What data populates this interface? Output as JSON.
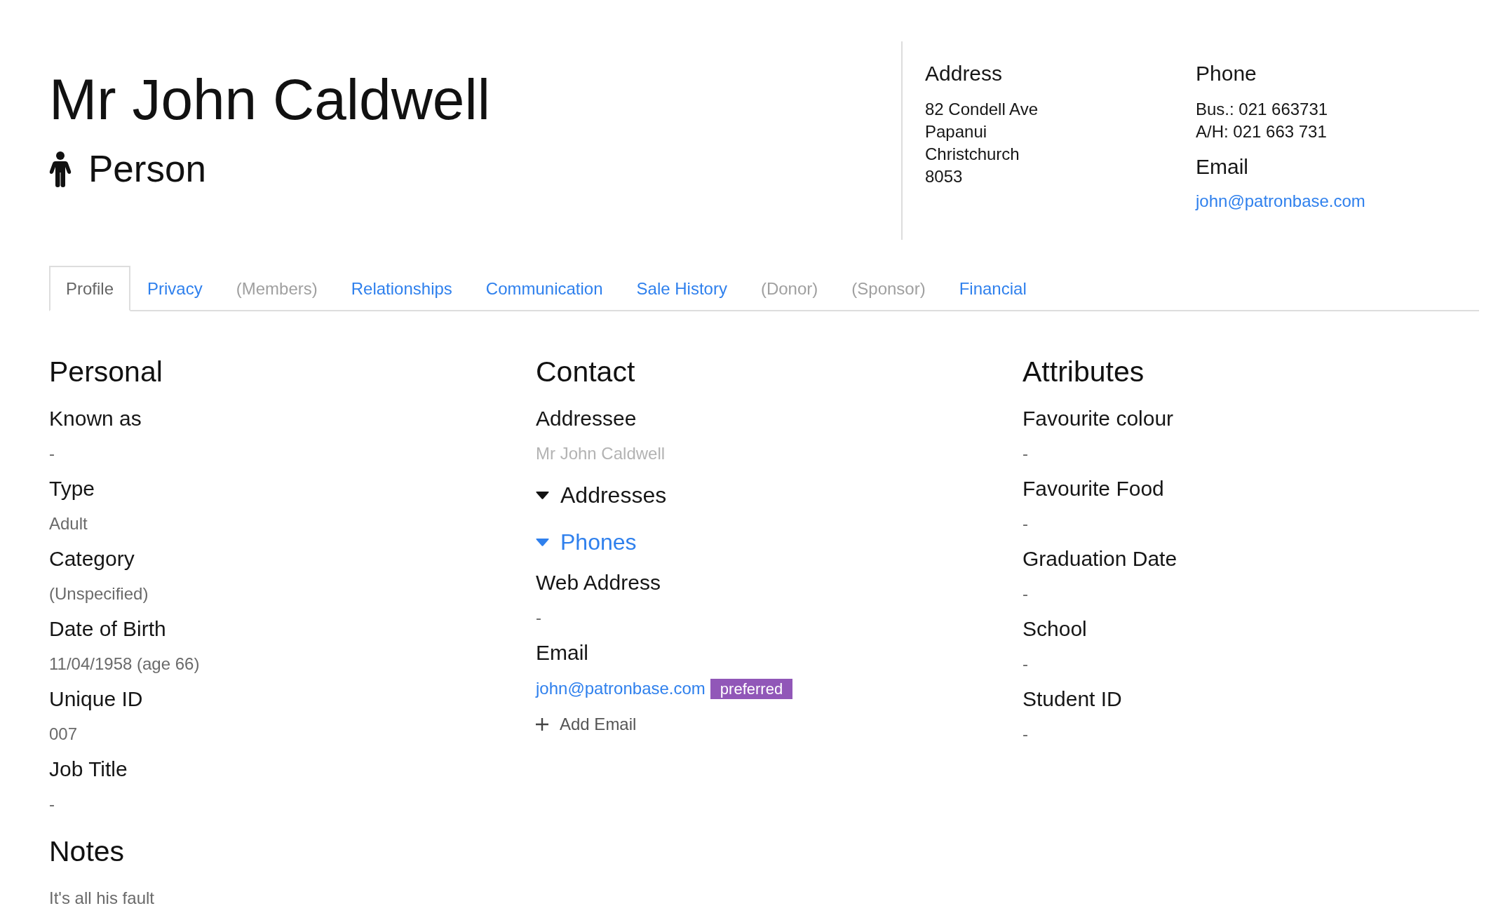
{
  "header": {
    "name": "Mr John Caldwell",
    "entity_type": "Person",
    "address": {
      "heading": "Address",
      "lines": [
        "82 Condell Ave",
        "Papanui",
        "Christchurch",
        "8053"
      ]
    },
    "phone": {
      "heading": "Phone",
      "lines": [
        "Bus.: 021 663731",
        "A/H: 021 663 731"
      ]
    },
    "email": {
      "heading": "Email",
      "address": "john@patronbase.com"
    }
  },
  "tabs": [
    {
      "label": "Profile",
      "selected": true,
      "disabled": false
    },
    {
      "label": "Privacy",
      "selected": false,
      "disabled": false
    },
    {
      "label": "(Members)",
      "selected": false,
      "disabled": true
    },
    {
      "label": "Relationships",
      "selected": false,
      "disabled": false
    },
    {
      "label": "Communication",
      "selected": false,
      "disabled": false
    },
    {
      "label": "Sale History",
      "selected": false,
      "disabled": false
    },
    {
      "label": "(Donor)",
      "selected": false,
      "disabled": true
    },
    {
      "label": "(Sponsor)",
      "selected": false,
      "disabled": true
    },
    {
      "label": "Financial",
      "selected": false,
      "disabled": false
    }
  ],
  "personal": {
    "heading": "Personal",
    "fields": [
      {
        "label": "Known as",
        "value": "-"
      },
      {
        "label": "Type",
        "value": "Adult"
      },
      {
        "label": "Category",
        "value": "(Unspecified)"
      },
      {
        "label": "Date of Birth",
        "value": "11/04/1958 (age 66)"
      },
      {
        "label": "Unique ID",
        "value": "007"
      },
      {
        "label": "Job Title",
        "value": "-"
      }
    ]
  },
  "notes": {
    "heading": "Notes",
    "text": "It's all his fault"
  },
  "contact": {
    "heading": "Contact",
    "items": [
      {
        "kind": "field",
        "label": "Addressee",
        "value": "Mr John Caldwell",
        "muted": true
      },
      {
        "kind": "toggle",
        "label": "Addresses",
        "hovered": false
      },
      {
        "kind": "toggle",
        "label": "Phones",
        "hovered": true
      },
      {
        "kind": "field",
        "label": "Web Address",
        "value": "-",
        "muted": false
      },
      {
        "kind": "emails",
        "label": "Email",
        "emails": [
          {
            "address": "john@patronbase.com",
            "badge": "preferred"
          }
        ],
        "add_label": "Add Email"
      }
    ]
  },
  "attributes": {
    "heading": "Attributes",
    "fields": [
      {
        "label": "Favourite colour",
        "value": "-"
      },
      {
        "label": "Favourite Food",
        "value": "-"
      },
      {
        "label": "Graduation Date",
        "value": "-"
      },
      {
        "label": "School",
        "value": "-"
      },
      {
        "label": "Student ID",
        "value": "-"
      }
    ]
  }
}
